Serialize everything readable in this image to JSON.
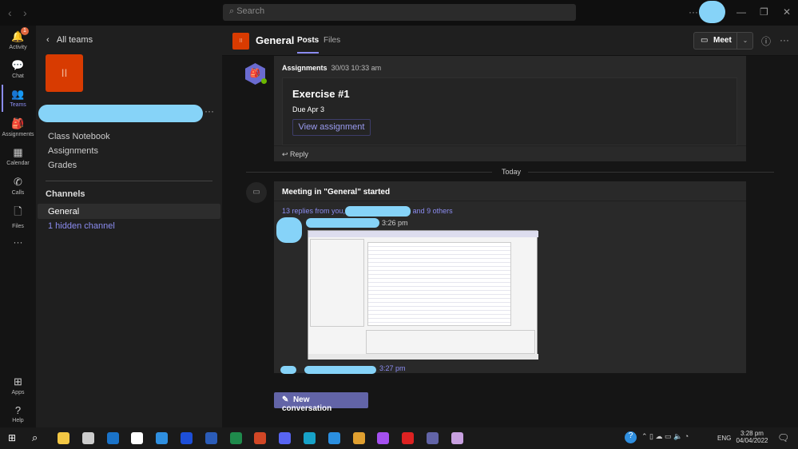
{
  "titlebar": {
    "back": "‹",
    "forward": "›",
    "search_placeholder": "Search",
    "more": "···",
    "minimize": "—",
    "restore": "❐",
    "close": "✕"
  },
  "rail": [
    {
      "label": "Activity",
      "icon": "bell-icon",
      "glyph": "🔔",
      "badge": "1"
    },
    {
      "label": "Chat",
      "icon": "chat-icon",
      "glyph": "💬"
    },
    {
      "label": "Teams",
      "icon": "teams-icon",
      "glyph": "👥",
      "active": true
    },
    {
      "label": "Assignments",
      "icon": "backpack-icon",
      "glyph": "🎒"
    },
    {
      "label": "Calendar",
      "icon": "calendar-icon",
      "glyph": "▦"
    },
    {
      "label": "Calls",
      "icon": "phone-icon",
      "glyph": "✆"
    },
    {
      "label": "Files",
      "icon": "file-icon",
      "glyph": "🗋"
    }
  ],
  "rail_more": "···",
  "rail_bottom": [
    {
      "label": "Apps",
      "glyph": "⊞"
    },
    {
      "label": "Help",
      "glyph": "?"
    }
  ],
  "panel": {
    "back_label": "All teams",
    "team_tile": "II",
    "more": "···",
    "links": [
      "Class Notebook",
      "Assignments",
      "Grades"
    ],
    "channels_heading": "Channels",
    "channels": [
      "General"
    ],
    "hidden": "1 hidden channel"
  },
  "header": {
    "tile": "II",
    "channel": "General",
    "tabs": [
      "Posts",
      "Files"
    ],
    "meet": "Meet",
    "info": "ⓘ",
    "more": "···"
  },
  "posts": {
    "assignment": {
      "author": "Assignments",
      "time": "30/03 10:33 am",
      "title": "Exercise #1",
      "due": "Due Apr 3",
      "button": "View assignment",
      "reply": "Reply"
    },
    "divider": "Today",
    "meeting": {
      "title": "Meeting in \"General\" started",
      "replies_prefix": "13 replies from you,",
      "replies_suffix": "and 9 others",
      "time1": "3:26 pm",
      "time2": "3:27 pm"
    }
  },
  "new_conversation": "New conversation",
  "taskbar": {
    "time": "3:28 pm",
    "date": "04/04/2022",
    "lang": "ENG",
    "icons": [
      "#f2c744",
      "#ccc",
      "#1a73c9",
      "#fff",
      "#2f8fe0",
      "#1d4fd8",
      "#2b5cb8",
      "#1f8a4c",
      "#d24726",
      "#5865f2",
      "#17a2c8",
      "#2b8fe0",
      "#e0a030",
      "#a550f0",
      "#d22",
      "#6264a7",
      "#c8a0e0"
    ]
  },
  "colors": {
    "accent": "#6264a7",
    "tile": "#d83b01",
    "link": "#8b8cf0"
  }
}
